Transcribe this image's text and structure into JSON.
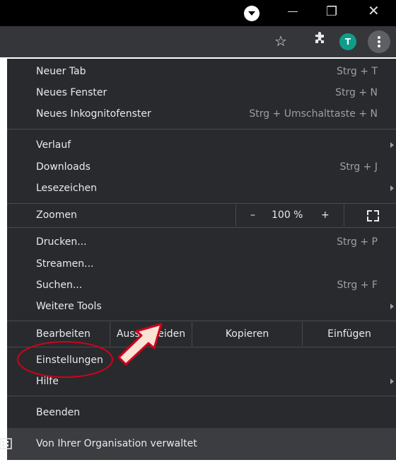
{
  "window": {
    "profile_icon": "profile-dropdown-icon",
    "minimize_icon": "minimize-icon",
    "maximize_icon": "restore-icon",
    "close_icon": "close-icon"
  },
  "toolbar": {
    "bookmark_icon": "star-icon",
    "extensions_icon": "puzzle-icon",
    "avatar_letter": "T",
    "avatar_color": "#0f9d8a",
    "menu_icon": "three-dots-icon"
  },
  "menu": {
    "new_tab": {
      "label": "Neuer Tab",
      "shortcut": "Strg + T"
    },
    "new_window": {
      "label": "Neues Fenster",
      "shortcut": "Strg + N"
    },
    "incognito": {
      "label": "Neues Inkognitofenster",
      "shortcut": "Strg + Umschalttaste + N"
    },
    "history": {
      "label": "Verlauf"
    },
    "downloads": {
      "label": "Downloads",
      "shortcut": "Strg + J"
    },
    "bookmarks": {
      "label": "Lesezeichen"
    },
    "zoom": {
      "label": "Zoomen",
      "minus": "–",
      "value": "100 %",
      "plus": "+"
    },
    "print": {
      "label": "Drucken...",
      "shortcut": "Strg + P"
    },
    "cast": {
      "label": "Streamen..."
    },
    "find": {
      "label": "Suchen...",
      "shortcut": "Strg + F"
    },
    "more_tools": {
      "label": "Weitere Tools"
    },
    "edit": {
      "label": "Bearbeiten",
      "cut": "Ausschneiden",
      "copy": "Kopieren",
      "paste": "Einfügen"
    },
    "settings": {
      "label": "Einstellungen"
    },
    "help": {
      "label": "Hilfe"
    },
    "exit": {
      "label": "Beenden"
    },
    "managed": {
      "label": "Von Ihrer Organisation verwaltet"
    }
  },
  "colors": {
    "menu_bg": "#292a2d",
    "annotation_red": "#d0021b",
    "arrow_fill": "#fbe3d6"
  }
}
